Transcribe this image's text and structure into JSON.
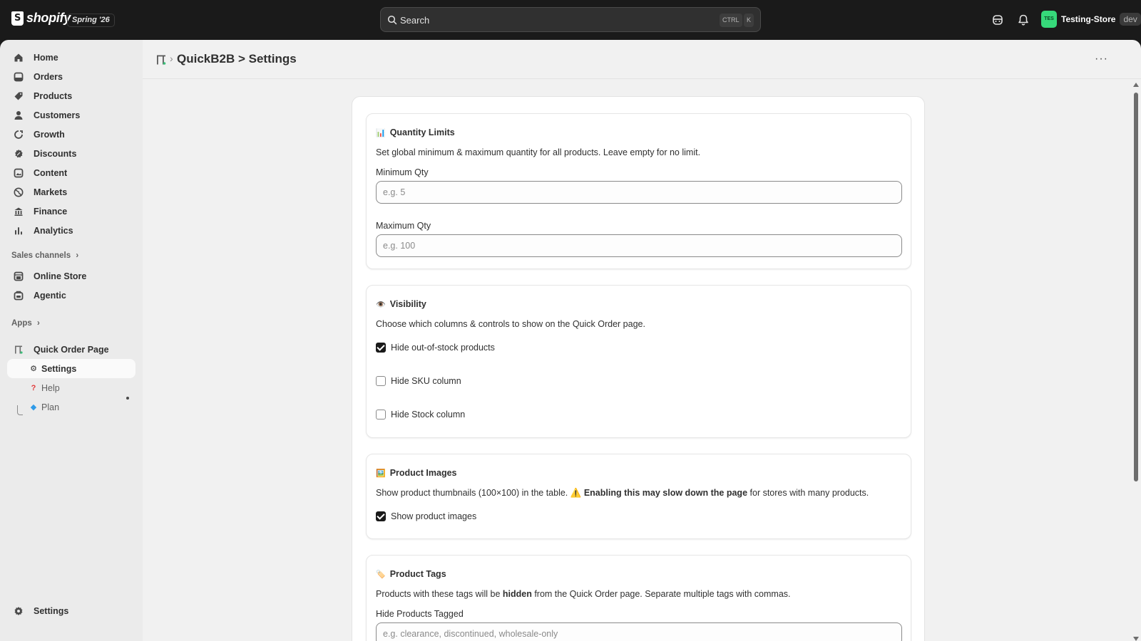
{
  "topbar": {
    "brand": "shopify",
    "edition_badge": "Spring '26",
    "search_placeholder": "Search",
    "shortcut_ctrl": "CTRL",
    "shortcut_key": "K",
    "store_initials": "TES",
    "store_name": "Testing-Store",
    "store_badge": "dev"
  },
  "sidebar": {
    "items": [
      {
        "label": "Home",
        "icon": "home-icon"
      },
      {
        "label": "Orders",
        "icon": "orders-icon"
      },
      {
        "label": "Products",
        "icon": "tag-icon"
      },
      {
        "label": "Customers",
        "icon": "person-icon"
      },
      {
        "label": "Growth",
        "icon": "growth-icon"
      },
      {
        "label": "Discounts",
        "icon": "discount-icon"
      },
      {
        "label": "Content",
        "icon": "content-icon"
      },
      {
        "label": "Markets",
        "icon": "globe-icon"
      },
      {
        "label": "Finance",
        "icon": "bank-icon"
      },
      {
        "label": "Analytics",
        "icon": "bar-chart-icon"
      }
    ],
    "sales_channels_label": "Sales channels",
    "channels": [
      {
        "label": "Online Store",
        "icon": "store-icon"
      },
      {
        "label": "Agentic",
        "icon": "agentic-icon"
      }
    ],
    "apps_label": "Apps",
    "app_name": "Quick Order Page",
    "app_sub_items": [
      {
        "label": "Settings",
        "emoji": "⚙️",
        "active": true
      },
      {
        "label": "Help",
        "emoji": "❓",
        "active": false
      },
      {
        "label": "Plan",
        "emoji": "💎",
        "active": false
      }
    ],
    "footer_settings": "Settings"
  },
  "header": {
    "title": "QuickB2B > Settings",
    "more": "···"
  },
  "sections": {
    "quantity": {
      "emoji": "📊",
      "title": "Quantity Limits",
      "desc": "Set global minimum & maximum quantity for all products. Leave empty for no limit.",
      "min_label": "Minimum Qty",
      "min_placeholder": "e.g. 5",
      "max_label": "Maximum Qty",
      "max_placeholder": "e.g. 100"
    },
    "visibility": {
      "emoji": "👁️",
      "title": "Visibility",
      "desc": "Choose which columns & controls to show on the Quick Order page.",
      "options": [
        {
          "label": "Hide out-of-stock products",
          "checked": true
        },
        {
          "label": "Hide SKU column",
          "checked": false
        },
        {
          "label": "Hide Stock column",
          "checked": false
        }
      ]
    },
    "images": {
      "emoji": "🖼️",
      "title": "Product Images",
      "desc_before": "Show product thumbnails (100×100) in the table.",
      "warning_emoji": "⚠️",
      "desc_bold": "Enabling this may slow down the page",
      "desc_after": "for stores with many products.",
      "option_label": "Show product images",
      "option_checked": true
    },
    "tags": {
      "emoji": "🏷️",
      "title": "Product Tags",
      "desc_before": "Products with these tags will be",
      "desc_bold": "hidden",
      "desc_after": "from the Quick Order page. Separate multiple tags with commas.",
      "field_label": "Hide Products Tagged",
      "field_placeholder": "e.g. clearance, discontinued, wholesale-only"
    }
  },
  "colors": {
    "topbar": "#1a1a1a",
    "sidebar": "#ebebeb",
    "main": "#f1f1f1",
    "avatar": "#36d97a"
  }
}
